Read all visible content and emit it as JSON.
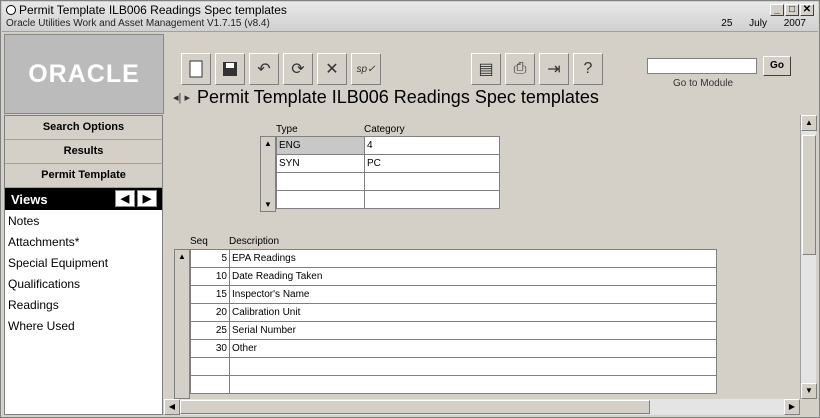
{
  "window": {
    "title": "Permit Template ILB006 Readings Spec templates",
    "subtitle": "Oracle Utilities Work and Asset Management V1.7.15 (v8.4)",
    "date": "25 July 2007",
    "min": "_",
    "max": "□",
    "close": "✕"
  },
  "logo": "ORACLE",
  "page_header": "Permit Template ILB006 Readings Spec templates",
  "goto": {
    "value": "",
    "label": "Go to Module",
    "button": "Go"
  },
  "sidebar": {
    "search_options": "Search Options",
    "results": "Results",
    "permit_template": "Permit Template",
    "views_label": "Views",
    "views": [
      "Notes",
      "Attachments*",
      "Special Equipment",
      "Qualifications",
      "Readings",
      "Where Used"
    ]
  },
  "type_grid": {
    "headers": {
      "type": "Type",
      "category": "Category"
    },
    "rows": [
      {
        "type": "ENG",
        "category": "4"
      },
      {
        "type": "SYN",
        "category": "PC"
      },
      {
        "type": "",
        "category": ""
      },
      {
        "type": "",
        "category": ""
      }
    ]
  },
  "desc_grid": {
    "headers": {
      "seq": "Seq",
      "description": "Description"
    },
    "rows": [
      {
        "seq": "5",
        "description": "EPA Readings"
      },
      {
        "seq": "10",
        "description": "Date Reading Taken"
      },
      {
        "seq": "15",
        "description": "Inspector's Name"
      },
      {
        "seq": "20",
        "description": "Calibration Unit"
      },
      {
        "seq": "25",
        "description": "Serial Number"
      },
      {
        "seq": "30",
        "description": "Other"
      },
      {
        "seq": "",
        "description": ""
      },
      {
        "seq": "",
        "description": ""
      }
    ]
  },
  "icons": [
    "new-icon",
    "save-icon",
    "undo-icon",
    "refresh-icon",
    "delete-icon",
    "spell-check-icon",
    "report-icon",
    "print-icon",
    "export-icon",
    "help-icon"
  ]
}
